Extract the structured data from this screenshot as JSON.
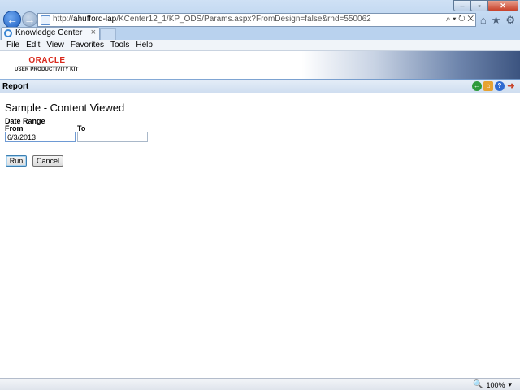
{
  "browser": {
    "url_prefix": "http://",
    "url_host": "ahufford-lap",
    "url_path": "/KCenter12_1/KP_ODS/Params.aspx?FromDesign=false&rnd=550062",
    "address_actions": "⌕ ▾ ↻ ✕",
    "window_controls": [
      "–",
      "▫",
      "✕"
    ],
    "right_icons": [
      "⌂",
      "★",
      "⚙"
    ]
  },
  "tab": {
    "label": "Knowledge Center",
    "close": "×"
  },
  "menu": [
    "File",
    "Edit",
    "View",
    "Favorites",
    "Tools",
    "Help"
  ],
  "logo": {
    "brand": "ORACLE",
    "product": "USER PRODUCTIVITY KIT"
  },
  "report_bar": {
    "title": "Report"
  },
  "form": {
    "heading": "Sample - Content Viewed",
    "date_range_label": "Date Range",
    "from_label": "From",
    "to_label": "To",
    "from_value": "6/3/2013",
    "to_value": "",
    "run_label": "Run",
    "cancel_label": "Cancel"
  },
  "status": {
    "zoom": "100%"
  }
}
